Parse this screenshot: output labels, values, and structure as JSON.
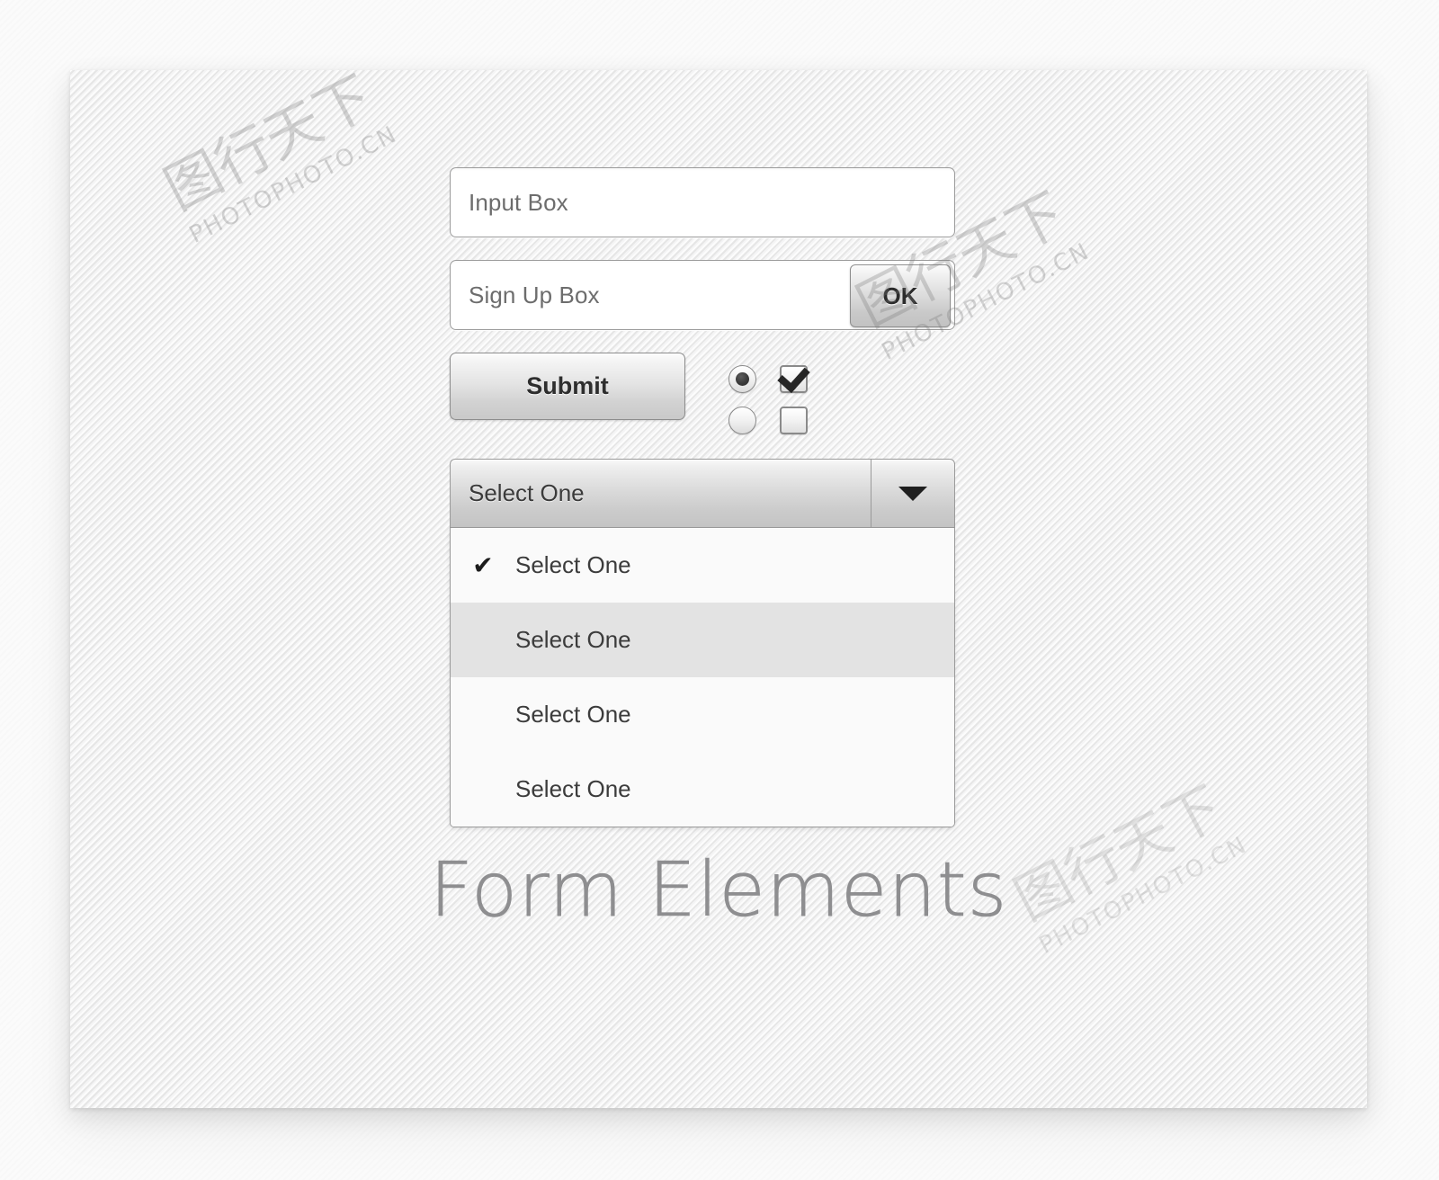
{
  "panel": {
    "title": "Form Elements"
  },
  "fields": {
    "input_box": {
      "placeholder": "Input Box",
      "value": ""
    },
    "signup_box": {
      "placeholder": "Sign Up Box",
      "value": "",
      "button_label": "OK"
    }
  },
  "buttons": {
    "submit_label": "Submit"
  },
  "toggles": {
    "radio_top_state": "selected",
    "radio_bottom_state": "unselected",
    "checkbox_top_state": "checked",
    "checkbox_bottom_state": "unchecked"
  },
  "select": {
    "selected_value": "Select One",
    "caret_icon": "chevron-down-icon",
    "options": [
      {
        "label": "Select One",
        "checked": true,
        "hovered": false,
        "tick": "✔"
      },
      {
        "label": "Select One",
        "checked": false,
        "hovered": true,
        "tick": ""
      },
      {
        "label": "Select One",
        "checked": false,
        "hovered": false,
        "tick": ""
      },
      {
        "label": "Select One",
        "checked": false,
        "hovered": false,
        "tick": ""
      }
    ]
  },
  "watermarks": [
    {
      "main": "图行天下",
      "sub": "PHOTOPHOTO.CN"
    },
    {
      "main": "图行天下",
      "sub": "PHOTOPHOTO.CN"
    },
    {
      "main": "图行天下",
      "sub": "PHOTOPHOTO.CN"
    }
  ],
  "colors": {
    "panel_bg": "#ececed",
    "field_bg": "#ffffff",
    "field_border": "#9c9c9c",
    "text": "#3b3b3b",
    "placeholder": "#6d6d6d",
    "title": "#8e8e90",
    "option_hover_bg": "#e3e3e3",
    "caret": "#1f1f1f"
  }
}
